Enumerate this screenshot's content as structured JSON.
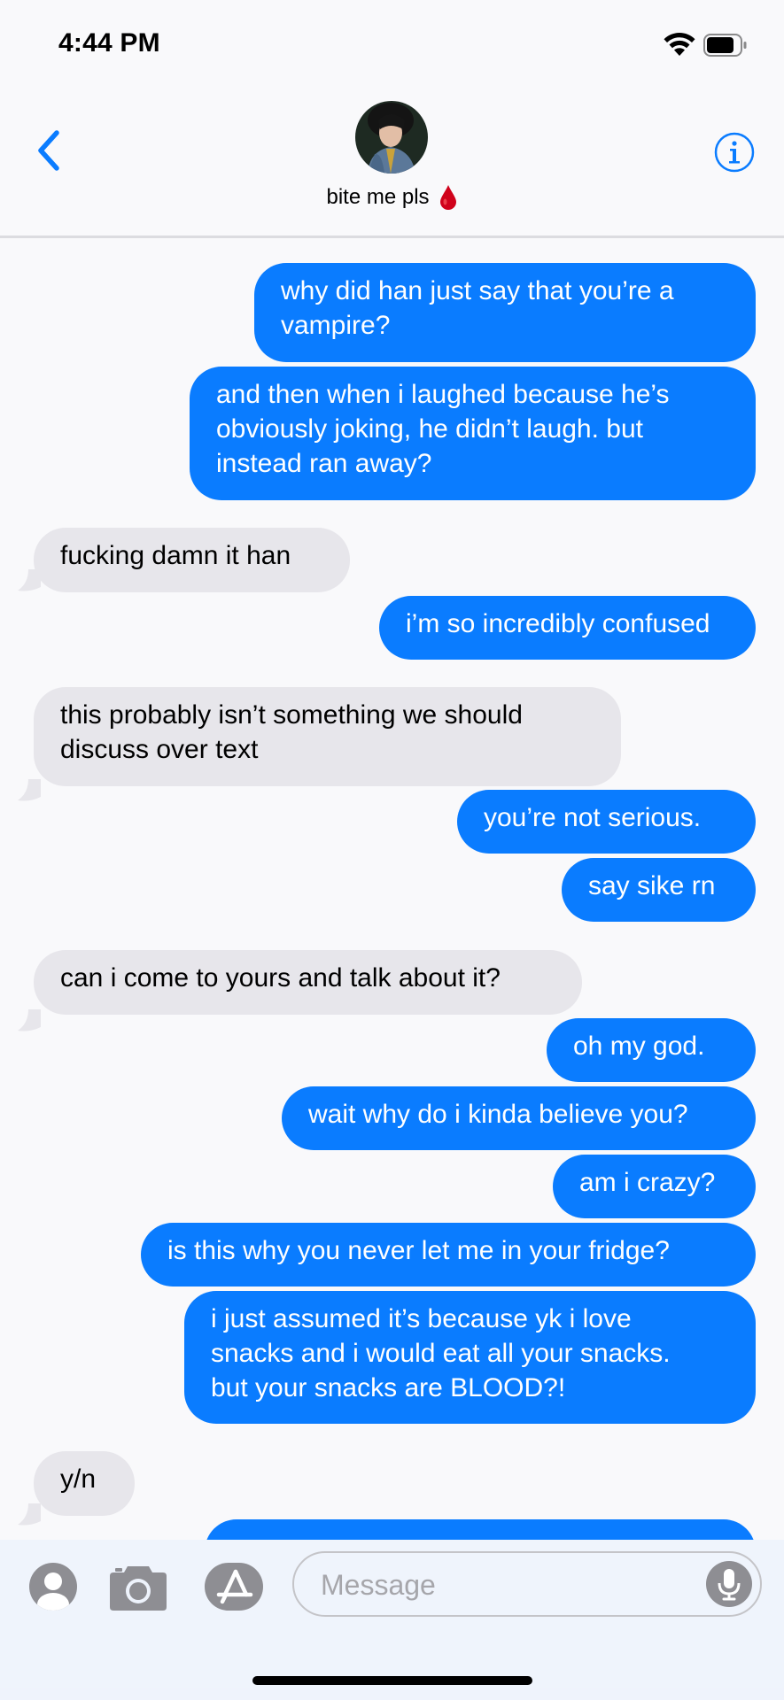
{
  "status_bar": {
    "time": "4:44 PM"
  },
  "header": {
    "contact_name": "bite me pls",
    "contact_emoji_icon": "blood-drop-icon",
    "back_icon": "chevron-left-icon",
    "info_icon": "info-icon"
  },
  "messages": [
    {
      "direction": "sent",
      "text": "why did han just say that you’re a\nvampire?"
    },
    {
      "direction": "sent",
      "text": "and then when i laughed because he’s\nobviously joking, he didn’t laugh. but\ninstead ran away?"
    },
    {
      "direction": "received",
      "text": "fucking damn it han"
    },
    {
      "direction": "sent",
      "text": "i’m so incredibly confused"
    },
    {
      "direction": "received",
      "text": "this probably isn’t something we should\ndiscuss over text"
    },
    {
      "direction": "sent",
      "text": "you’re not serious."
    },
    {
      "direction": "sent",
      "text": "say sike rn"
    },
    {
      "direction": "received",
      "text": "can i come to yours and talk about it?"
    },
    {
      "direction": "sent",
      "text": "oh my god."
    },
    {
      "direction": "sent",
      "text": "wait why do i kinda believe you?"
    },
    {
      "direction": "sent",
      "text": "am i crazy?"
    },
    {
      "direction": "sent",
      "text": "is this why you never let me in your fridge?"
    },
    {
      "direction": "sent",
      "text": "i just assumed it’s because yk i love\nsnacks and i would eat all your snacks.\nbut your snacks are BLOOD?!"
    },
    {
      "direction": "received",
      "text": "y/n"
    }
  ],
  "input_bar": {
    "placeholder": "Message",
    "icons": [
      "contacts-icon",
      "camera-icon",
      "app-store-icon",
      "microphone-icon"
    ]
  },
  "colors": {
    "sent_bubble": "#0a7cff",
    "received_bubble": "#e7e6eb",
    "accent": "#0a7cff",
    "background": "#f9f9fb"
  }
}
